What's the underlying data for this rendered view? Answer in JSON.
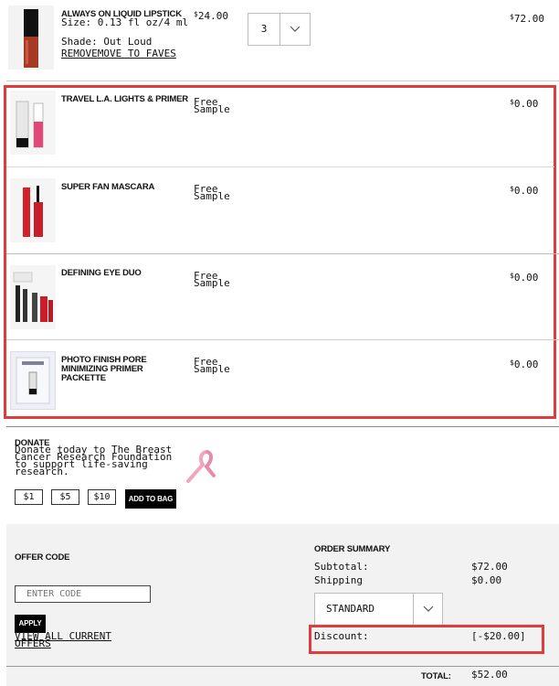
{
  "items": [
    {
      "name": "ALWAYS ON LIQUID LIPSTICK",
      "size": "Size: 0.13 fl oz/4 ml",
      "shade": "Shade: Out Loud",
      "remove": "REMOVE",
      "faves": "MOVE TO FAVES",
      "unit_price": "24.00",
      "quantity": "3",
      "total": "72.00"
    },
    {
      "name": "TRAVEL L.A. LIGHTS & PRIMER",
      "price_note": "Free Sample",
      "total": "0.00"
    },
    {
      "name": "SUPER FAN MASCARA",
      "price_note": "Free Sample",
      "total": "0.00"
    },
    {
      "name": "DEFINING EYE DUO",
      "price_note": "Free Sample",
      "total": "0.00"
    },
    {
      "name": "PHOTO FINISH PORE MINIMIZING PRIMER PACKETTE",
      "price_note": "Free Sample",
      "total": "0.00"
    }
  ],
  "currency": "$",
  "donate": {
    "title": "DONATE",
    "text": "Donate today to The Breast Cancer Research Foundation to support life-saving research.",
    "amounts": [
      "$1",
      "$5",
      "$10"
    ],
    "add_button": "ADD TO BAG"
  },
  "offer": {
    "title": "OFFER CODE",
    "placeholder": "ENTER CODE",
    "apply": "APPLY",
    "view_all": "VIEW ALL CURRENT OFFERS"
  },
  "summary": {
    "title": "ORDER SUMMARY",
    "subtotal_label": "Subtotal:",
    "subtotal_value": "$72.00",
    "shipping_label": "Shipping",
    "shipping_value": "$0.00",
    "shipping_method": "STANDARD",
    "discount_label": "Discount:",
    "discount_value": "[-$20.00]",
    "total_label": "TOTAL:",
    "total_value": "$52.00"
  },
  "colors": {
    "highlight": "#e03c3c",
    "summary_bg": "#f2f2f2"
  }
}
